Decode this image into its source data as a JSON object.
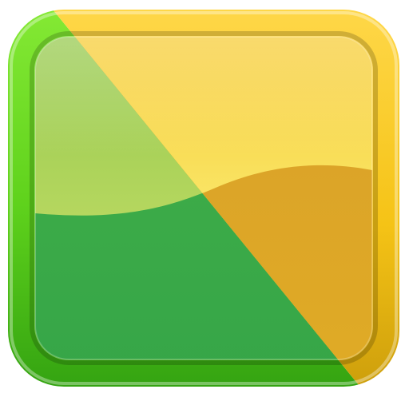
{
  "icon": {
    "name": "app-launcher-icon",
    "description_shape": "rounded-square tile split diagonally",
    "colors": {
      "green_frame": "#5fd21c",
      "green_frame_dark": "#2f9e10",
      "green_frame_light": "#9cf04a",
      "yellow_frame": "#f5c316",
      "yellow_frame_dark": "#c89a0a",
      "yellow_frame_light": "#ffe46a",
      "green_upper": "#a9cf57",
      "green_lower": "#3aaa48",
      "yellow_upper": "#f8d83a",
      "yellow_lower": "#dca22c"
    }
  }
}
